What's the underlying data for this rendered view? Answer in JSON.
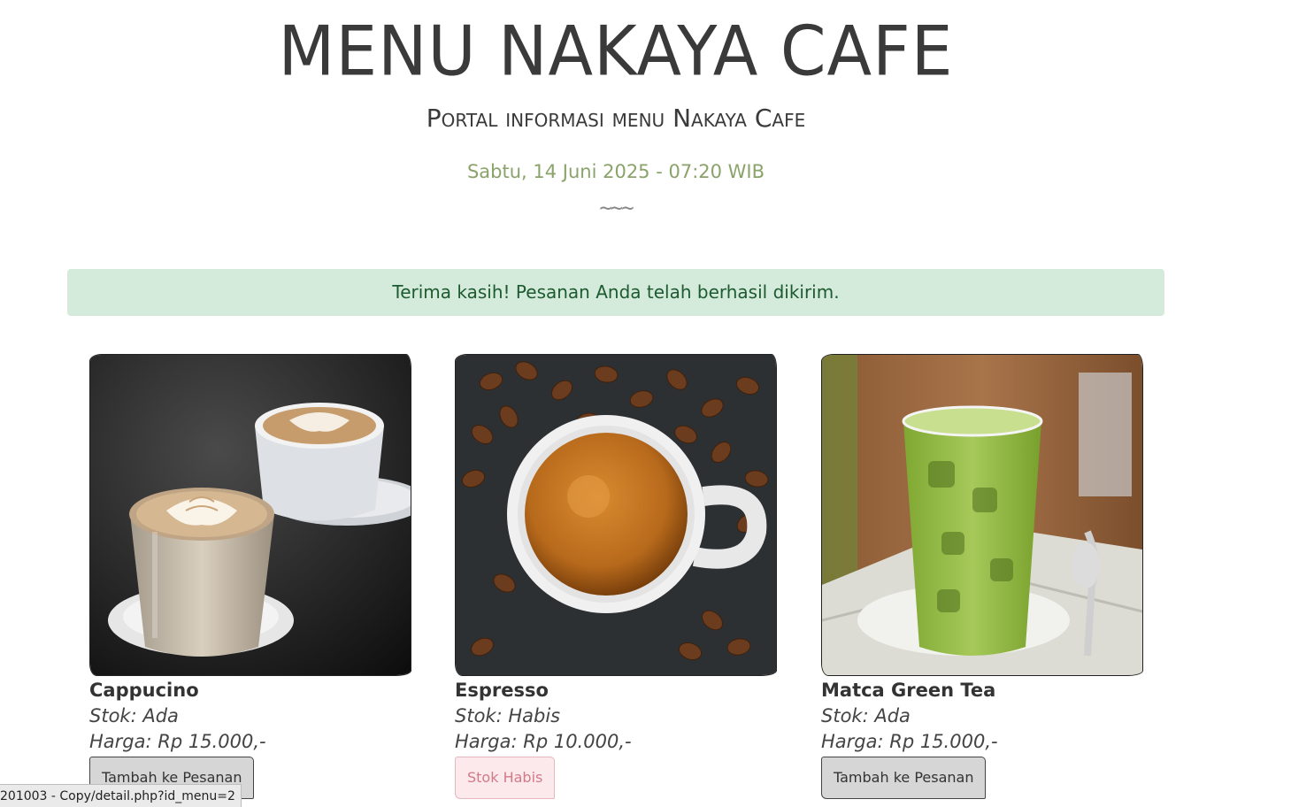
{
  "header": {
    "title": "MENU NAKAYA CAFE",
    "subtitle": "Portal informasi menu Nakaya Cafe",
    "datetime": "Sabtu, 14 Juni 2025 - 07:20 WIB",
    "divider": "~~~"
  },
  "alert": {
    "message": "Terima kasih! Pesanan Anda telah berhasil dikirim."
  },
  "menu": [
    {
      "name": "Cappucino",
      "stock": "Stok: Ada",
      "price": "Harga: Rp 15.000,-",
      "button": "Tambah ke Pesanan",
      "available": true,
      "image_subject": "cappuccino-latte-art-image"
    },
    {
      "name": "Espresso",
      "stock": "Stok: Habis",
      "price": "Harga: Rp 10.000,-",
      "button": "Stok Habis",
      "available": false,
      "image_subject": "espresso-cup-coffee-beans-image"
    },
    {
      "name": "Matca Green Tea",
      "stock": "Stok: Ada",
      "price": "Harga: Rp 15.000,-",
      "button": "Tambah ke Pesanan",
      "available": true,
      "image_subject": "iced-matcha-glass-image"
    }
  ],
  "statusbar": {
    "url": "201003 - Copy/detail.php?id_menu=2"
  },
  "colors": {
    "accent_green_text": "#8aa36a",
    "alert_bg": "#d4ebdc",
    "alert_text": "#1d5a2f",
    "disabled_btn_bg": "#fbe9ec",
    "disabled_btn_text": "#d27a88"
  }
}
